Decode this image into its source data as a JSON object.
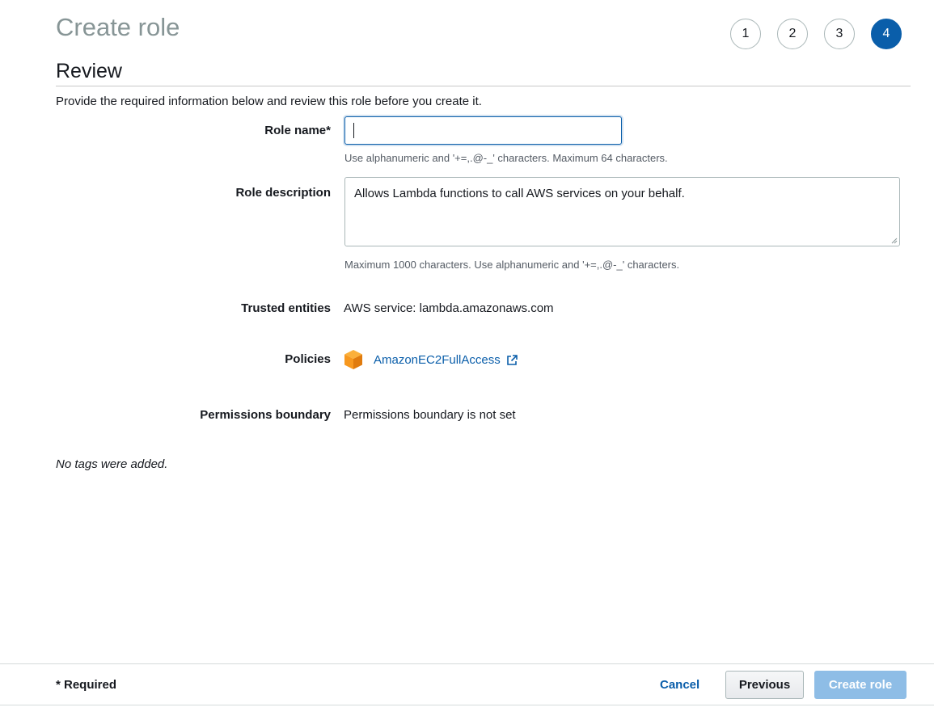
{
  "page": {
    "title": "Create role",
    "steps": [
      "1",
      "2",
      "3",
      "4"
    ],
    "active_step": "4",
    "subtitle": "Review",
    "intro": "Provide the required information below and review this role before you create it."
  },
  "form": {
    "role_name_label": "Role name*",
    "role_name_value": "",
    "role_name_hint": "Use alphanumeric and '+=,.@-_' characters. Maximum 64 characters.",
    "role_description_label": "Role description",
    "role_description_value": "Allows Lambda functions to call AWS services on your behalf.",
    "role_description_hint": "Maximum 1000 characters. Use alphanumeric and '+=,.@-_' characters.",
    "trusted_entities_label": "Trusted entities",
    "trusted_entities_value": "AWS service: lambda.amazonaws.com",
    "policies_label": "Policies",
    "policies": [
      {
        "name": "AmazonEC2FullAccess",
        "icon": "aws-managed-policy-cube-icon"
      }
    ],
    "permissions_boundary_label": "Permissions boundary",
    "permissions_boundary_value": "Permissions boundary is not set"
  },
  "tags": {
    "empty_message": "No tags were added."
  },
  "footer": {
    "required_note": "* Required",
    "cancel_label": "Cancel",
    "previous_label": "Previous",
    "create_label": "Create role"
  },
  "colors": {
    "accent": "#0a5eaa",
    "title_gray": "#879596",
    "create_disabled": "#8ebde6",
    "policy_icon": "#f7981f"
  }
}
